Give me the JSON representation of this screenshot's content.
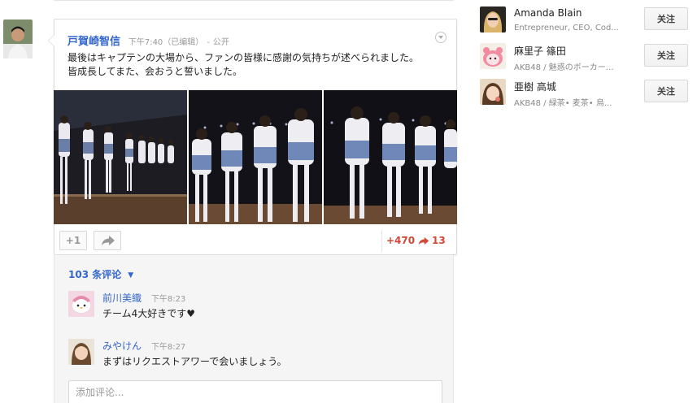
{
  "post": {
    "author": "戸賀崎智信",
    "time": "下午7:40",
    "edited": "（已编辑）",
    "separator": "-",
    "visibility": "公开",
    "text_lines": [
      "最後はキャプテンの大場から、ファンの皆様に感謝の気持ちが述べられました。",
      "皆成長してまた、会おうと誓いました。"
    ],
    "plus_one_label": "+1",
    "plus_count": "+470",
    "share_count": "13",
    "icons": {
      "menu": "chevron-down-circle-icon",
      "share": "share-arrow-icon"
    }
  },
  "comments": {
    "count_label": "103 条评论",
    "toggle_icon": "chevron-down-icon",
    "items": [
      {
        "author": "前川美織",
        "time": "下午8:23",
        "text": "チーム4大好きです♥"
      },
      {
        "author": "みやけん",
        "time": "下午8:27",
        "text": "まずはリクエストアワーで会いましょう。"
      }
    ],
    "input_placeholder": "添加评论..."
  },
  "suggestions": [
    {
      "name": "Amanda Blain",
      "desc": "Entrepreneur, CEO, Cod...",
      "button": "关注"
    },
    {
      "name": "麻里子 篠田",
      "desc": "AKB48 / 魅惑のボーカー…",
      "button": "关注"
    },
    {
      "name": "亜樹 高城",
      "desc": "AKB48 / 緑茶• 麦茶• 烏...",
      "button": "关注"
    }
  ],
  "colors": {
    "link_blue": "#3366cc",
    "accent_red": "#d14836",
    "meta_gray": "#999999"
  }
}
